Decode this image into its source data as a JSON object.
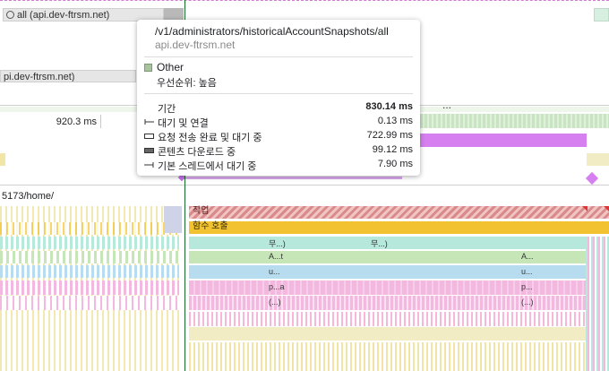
{
  "tracks": {
    "network_header_1": "all (api.dev-ftrsm.net)",
    "network_header_2": "pi.dev-ftrsm.net)",
    "time_label": "920.3 ms",
    "more_dots": "...",
    "main_thread_url": "5173/home/"
  },
  "flame": {
    "task_label": "작업",
    "call_label": "함수 호출",
    "row_labels_a": [
      "무...)",
      "A...t",
      "u...",
      "p...a",
      "(...)"
    ],
    "row_labels_b": [
      "무...)"
    ],
    "row_labels_c": [
      "A...",
      "u...",
      "p...",
      "(...)"
    ]
  },
  "tooltip": {
    "url": "/v1/administrators/historicalAccountSnapshots/all",
    "host": "api.dev-ftrsm.net",
    "category": "Other",
    "priority": "우선순위: 높음",
    "rows": [
      {
        "label": "기간",
        "value": "830.14 ms",
        "icon": "none-icon"
      },
      {
        "label": "대기 및 연결",
        "value": "0.13 ms",
        "icon": "whisker-icon"
      },
      {
        "label": "요청 전송 완료 및 대기 중",
        "value": "722.99 ms",
        "icon": "hollow-box-icon"
      },
      {
        "label": "콘텐츠 다운로드 중",
        "value": "99.12 ms",
        "icon": "filled-box-icon"
      },
      {
        "label": "기본 스레드에서 대기 중",
        "value": "7.90 ms",
        "icon": "arrow-line-icon"
      }
    ]
  },
  "colors": {
    "network_green": "#a9c3a1",
    "request_purple": "#d67ff0",
    "task_red": "#d98a8a",
    "call_yellow": "#f2c230",
    "teal": "#b6e8dc",
    "green": "#c6e6b8",
    "blue": "#b7dcef",
    "pink": "#f3b8df",
    "cream": "#f2ecc4",
    "cursor": "#176a2a"
  }
}
